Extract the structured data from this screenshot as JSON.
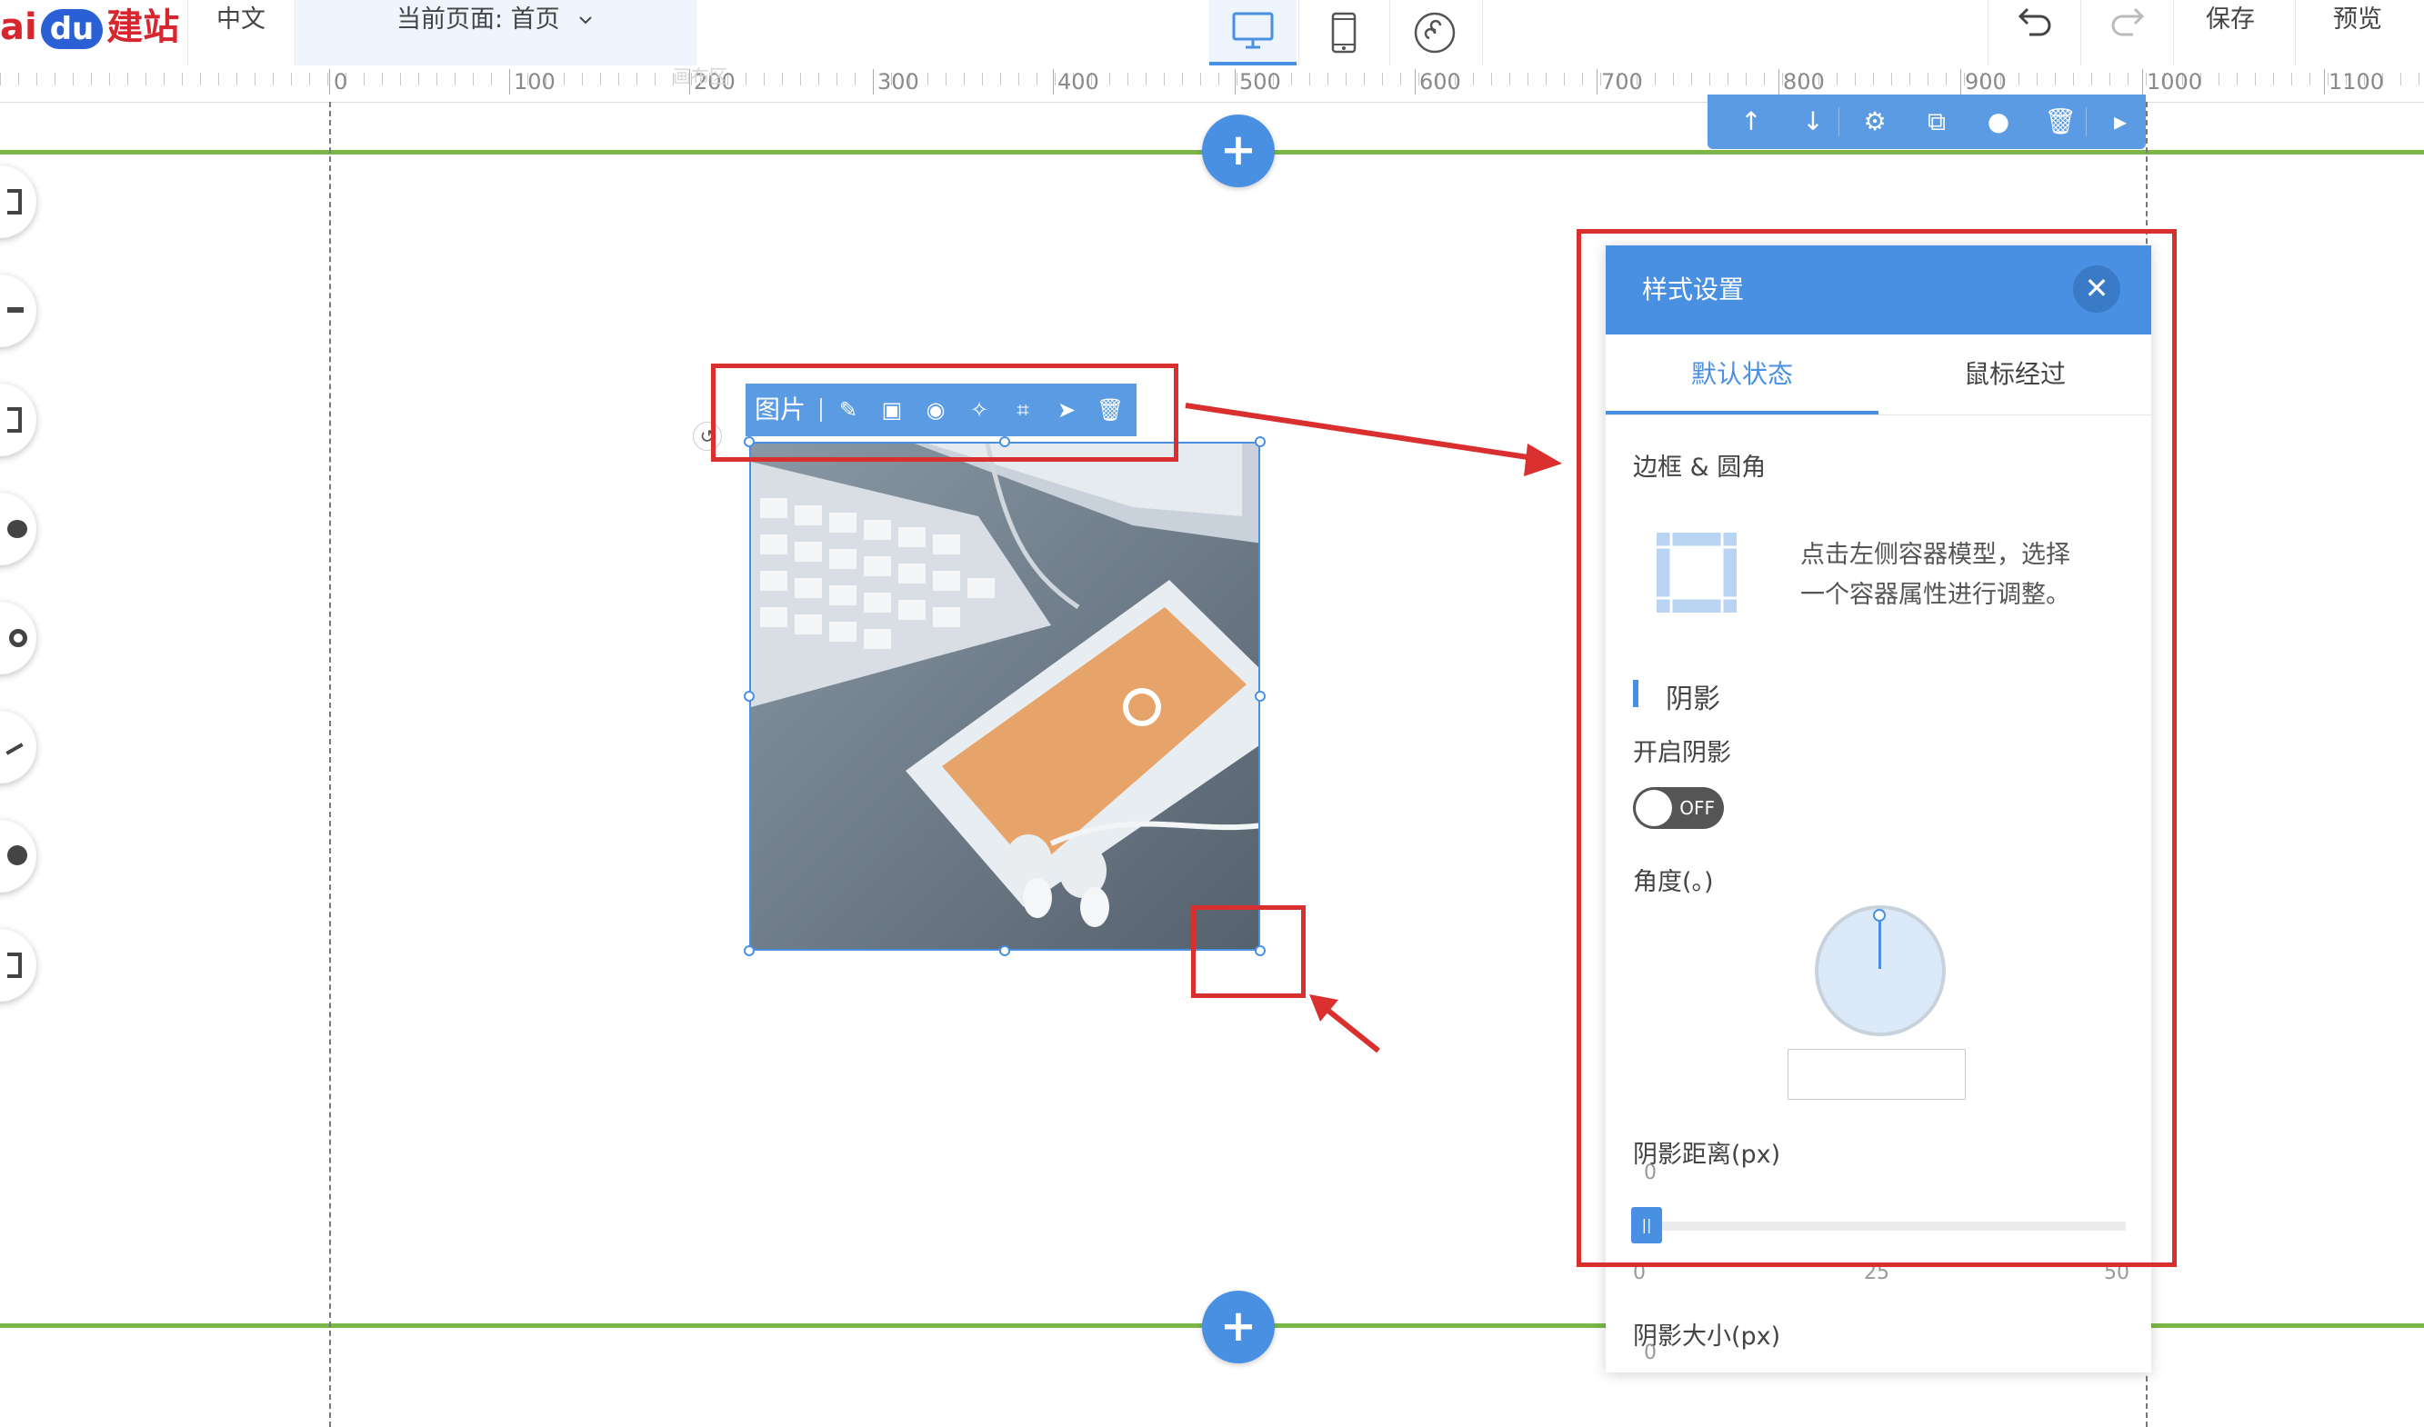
{
  "topbar": {
    "logo_prefix": "ai",
    "logo_du": "du",
    "logo_suffix": "建站",
    "language": "中文",
    "current_page": "当前页面: 首页",
    "save": "保存",
    "preview": "预览"
  },
  "ruler": {
    "labels": [
      "0",
      "100",
      "200",
      "300",
      "400",
      "500",
      "600",
      "700",
      "800",
      "900",
      "1000",
      "1100"
    ],
    "faint_label": "画布区"
  },
  "image_toolbar": {
    "label": "图片",
    "icons": [
      "edit-icon",
      "image-icon",
      "palette-icon",
      "magic-wand-icon",
      "crop-icon",
      "send-icon",
      "trash-icon"
    ]
  },
  "component_toolbar": {
    "icons": [
      "arrow-up-icon",
      "arrow-down-icon",
      "gear-icon",
      "copy-icon",
      "globe-icon",
      "trash-icon",
      "play-icon"
    ]
  },
  "style_panel": {
    "title": "样式设置",
    "tabs": [
      {
        "label": "默认状态",
        "active": true
      },
      {
        "label": "鼠标经过",
        "active": false
      }
    ],
    "border_section": "边框 & 圆角",
    "border_hint_line1": "点击左侧容器模型，选择",
    "border_hint_line2": "一个容器属性进行调整。",
    "shadow_section": "阴影",
    "enable_shadow": "开启阴影",
    "toggle_label": "OFF",
    "angle_label": "角度(。)",
    "angle_value": "",
    "distance_label": "阴影距离(px)",
    "distance_value": "0",
    "slider_ticks": [
      "0",
      "25",
      "50"
    ],
    "size_label": "阴影大小(px)",
    "size_value": "0"
  },
  "colors": {
    "accent": "#4a90e2",
    "annotation_red": "#d9302f",
    "guide_green": "#7ab648"
  }
}
